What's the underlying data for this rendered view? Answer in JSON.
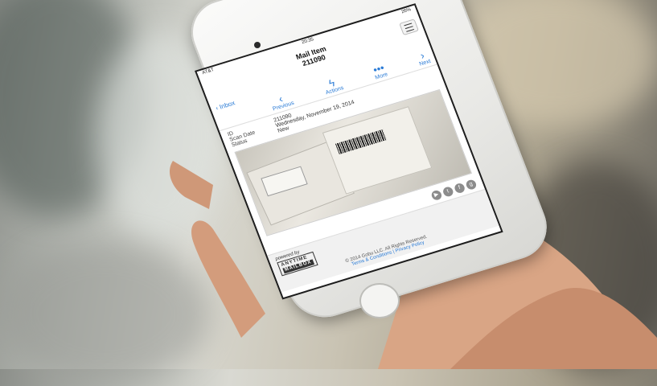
{
  "status_bar": {
    "carrier": "AT&T",
    "time": "20:35",
    "battery": "26%"
  },
  "header": {
    "title": "Mail Item",
    "subtitle": "211090"
  },
  "nav": {
    "back_label": "Inbox"
  },
  "toolbar": {
    "previous_label": "Previous",
    "actions_label": "Actions",
    "more_label": "More",
    "next_label": "Next"
  },
  "details": [
    {
      "key": "ID",
      "value": "211090"
    },
    {
      "key": "Scan Date",
      "value": "Wednesday, November 19, 2014"
    },
    {
      "key": "Status",
      "value": "New"
    }
  ],
  "social_icons": [
    "youtube-icon",
    "twitter-icon",
    "facebook-icon",
    "google-plus-icon"
  ],
  "footer": {
    "powered_by": "powered by",
    "logo_top": "ANYTIME",
    "logo_bottom": "MAILBOX",
    "copyright": "© 2014 Gobu LLC. All Rights Reserved.",
    "links": "Terms & Conditions | Privacy Policy"
  },
  "colors": {
    "accent": "#2a7bd6",
    "phone_body": "#f4f4f2"
  }
}
